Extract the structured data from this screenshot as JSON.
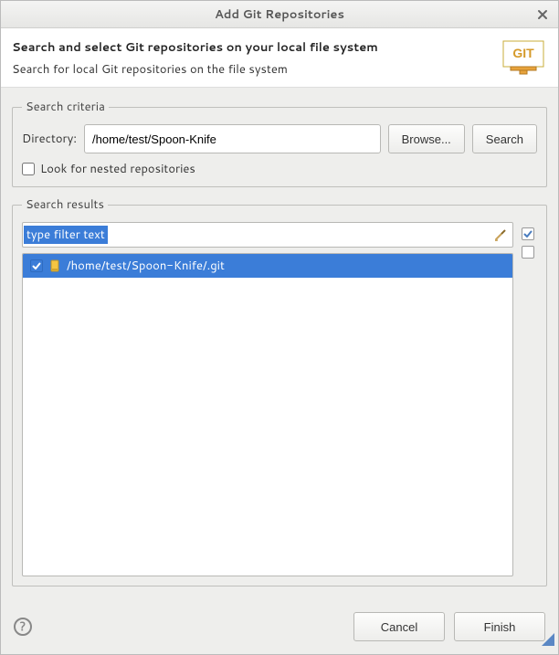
{
  "window": {
    "title": "Add Git Repositories"
  },
  "header": {
    "heading": "Search and select Git repositories on your local file system",
    "subheading": "Search for local Git repositories on the file system"
  },
  "criteria": {
    "legend": "Search criteria",
    "directory_label": "Directory:",
    "directory_value": "/home/test/Spoon-Knife",
    "browse_label": "Browse...",
    "search_label": "Search",
    "nested_label": "Look for nested repositories",
    "nested_checked": false
  },
  "results": {
    "legend": "Search results",
    "filter_placeholder": "type filter text",
    "items": [
      {
        "path": "/home/test/Spoon-Knife/.git",
        "checked": true,
        "selected": true
      }
    ]
  },
  "footer": {
    "cancel": "Cancel",
    "finish": "Finish"
  }
}
